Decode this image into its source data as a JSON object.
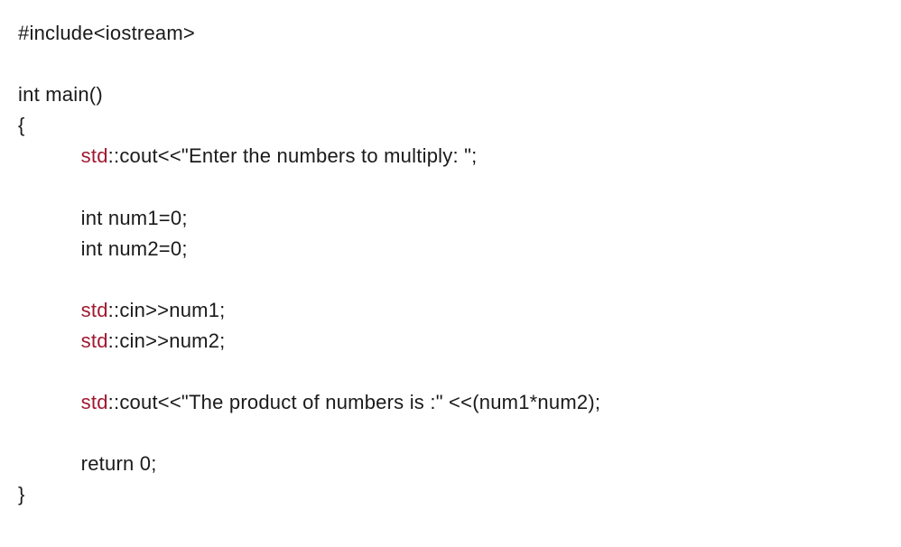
{
  "code": {
    "l1_include": "#include<iostream>",
    "l3_int_main": "int main()",
    "l4_brace": "{",
    "l5_std": "std",
    "l5_rest": "::cout<<\"Enter the numbers to multiply: \";",
    "l7_num1": "int num1=0;",
    "l8_num2": "int num2=0;",
    "l10_std": "std",
    "l10_rest": "::cin>>num1;",
    "l11_std": "std",
    "l11_rest": "::cin>>num2;",
    "l13_std": "std",
    "l13_rest": "::cout<<\"The product of numbers is :\" <<(num1*num2);",
    "l15_return": "return 0;",
    "l16_brace": "}",
    "indent": "           "
  }
}
